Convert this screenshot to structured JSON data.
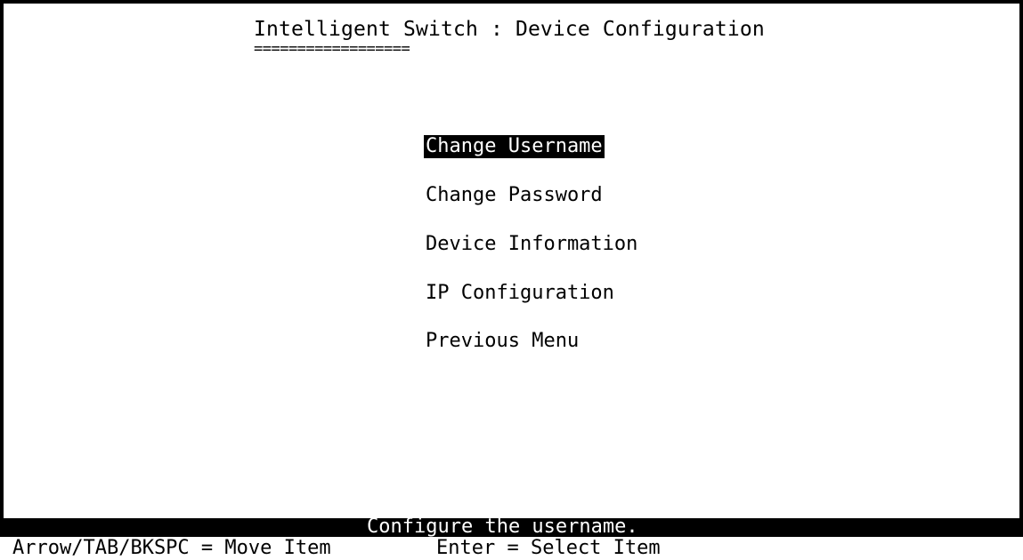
{
  "screen": {
    "title": "Intelligent Switch : Device Configuration",
    "title_underline": "=================="
  },
  "menu": {
    "selected_index": 0,
    "items": [
      {
        "label": "Change Username"
      },
      {
        "label": "Change Password"
      },
      {
        "label": "Device Information"
      },
      {
        "label": "IP Configuration"
      },
      {
        "label": "Previous Menu"
      }
    ]
  },
  "status": {
    "message": "Configure the username."
  },
  "help": {
    "navigation": "Arrow/TAB/BKSPC = Move Item",
    "select": "Enter = Select Item"
  },
  "colors": {
    "background": "#ffffff",
    "foreground": "#000000",
    "highlight_background": "#000000",
    "highlight_foreground": "#ffffff"
  }
}
